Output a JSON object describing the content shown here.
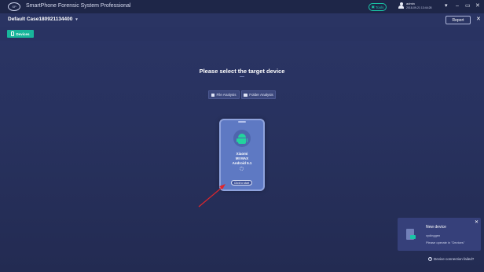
{
  "titlebar": {
    "logo_text": "SP",
    "title": "SmartPhone Forensic System Professional",
    "tools_label": "Tools",
    "user_name": "admin",
    "user_date": "2018-09-21 13:44:28",
    "dropdown_icon": "▾",
    "minimize": "–",
    "maximize": "▭",
    "close": "✕"
  },
  "case": {
    "title": "Default Case180921134400",
    "chevron": "▾",
    "report_label": "Report",
    "close": "✕"
  },
  "toolbar": {
    "devices_label": "Devices"
  },
  "main": {
    "title": "Please select the target device",
    "file_analysis": "File Analysis",
    "folder_analysis": "Folder Analysis"
  },
  "device": {
    "brand": "Xiaomi",
    "model": "MI MAX",
    "os": "Android 5.1",
    "click_label": "Click to start"
  },
  "notification": {
    "title": "New device",
    "subtitle": "xydinggen",
    "message": "Please operate in \"Devices\"",
    "close": "✕"
  },
  "footer": {
    "connection_failed": "Device connection failed?",
    "help_icon": "?"
  },
  "colors": {
    "background": "#2b3566",
    "accent": "#18b69b",
    "phone_card": "#5e79c3",
    "arrow": "#e0262c"
  }
}
